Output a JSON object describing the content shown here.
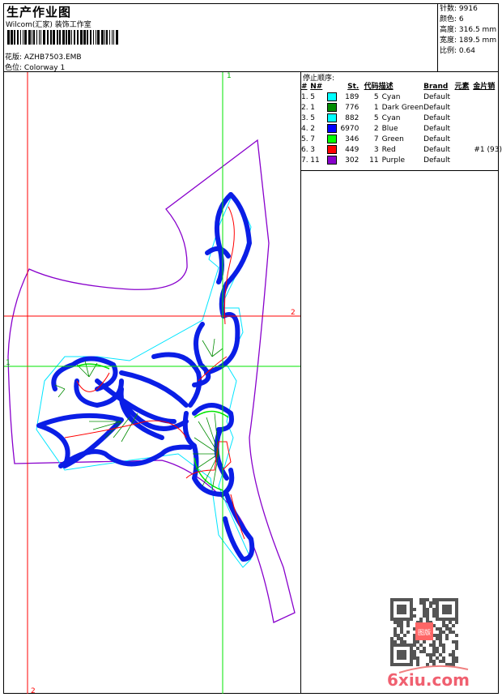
{
  "header": {
    "title": "生产作业图",
    "company": "Wilcom(汇家) 装饰工作室",
    "design_file_label": "花版:",
    "design_file": "AZHB7503.EMB",
    "colorway_label": "色位:",
    "colorway": "Colorway 1"
  },
  "stats": [
    {
      "label": "针数:",
      "value": "9916"
    },
    {
      "label": "颜色:",
      "value": "6"
    },
    {
      "label": "高度:",
      "value": "316.5 mm"
    },
    {
      "label": "宽度:",
      "value": "189.5 mm"
    },
    {
      "label": "比例:",
      "value": "0.64"
    }
  ],
  "stop_sequence": {
    "title": "停止顺序:",
    "columns": [
      "#",
      "N#",
      "",
      "St.",
      "代码",
      "描述",
      "Brand",
      "元素",
      "金片销"
    ],
    "rows": [
      {
        "idx": "1.",
        "n": "5",
        "color": "#00ffff",
        "st": "189",
        "code": "5",
        "desc": "Cyan",
        "brand": "Default",
        "element": "",
        "sequin": ""
      },
      {
        "idx": "2.",
        "n": "1",
        "color": "#008c00",
        "st": "776",
        "code": "1",
        "desc": "Dark Green",
        "brand": "Default",
        "element": "",
        "sequin": ""
      },
      {
        "idx": "3.",
        "n": "5",
        "color": "#00ffff",
        "st": "882",
        "code": "5",
        "desc": "Cyan",
        "brand": "Default",
        "element": "",
        "sequin": ""
      },
      {
        "idx": "4.",
        "n": "2",
        "color": "#0000ff",
        "st": "6970",
        "code": "2",
        "desc": "Blue",
        "brand": "Default",
        "element": "",
        "sequin": ""
      },
      {
        "idx": "5.",
        "n": "7",
        "color": "#00ff00",
        "st": "346",
        "code": "7",
        "desc": "Green",
        "brand": "Default",
        "element": "",
        "sequin": ""
      },
      {
        "idx": "6.",
        "n": "3",
        "color": "#ff0000",
        "st": "449",
        "code": "3",
        "desc": "Red",
        "brand": "Default",
        "element": "",
        "sequin": "#1 (93)"
      },
      {
        "idx": "7.",
        "n": "11",
        "color": "#8800cc",
        "st": "302",
        "code": "11",
        "desc": "Purple",
        "brand": "Default",
        "element": "",
        "sequin": ""
      }
    ]
  },
  "guides": {
    "v1": "1",
    "h2": "2",
    "h1": "1",
    "v2": "2"
  },
  "watermark": {
    "text": "6xiu.com",
    "seal": "图版"
  }
}
